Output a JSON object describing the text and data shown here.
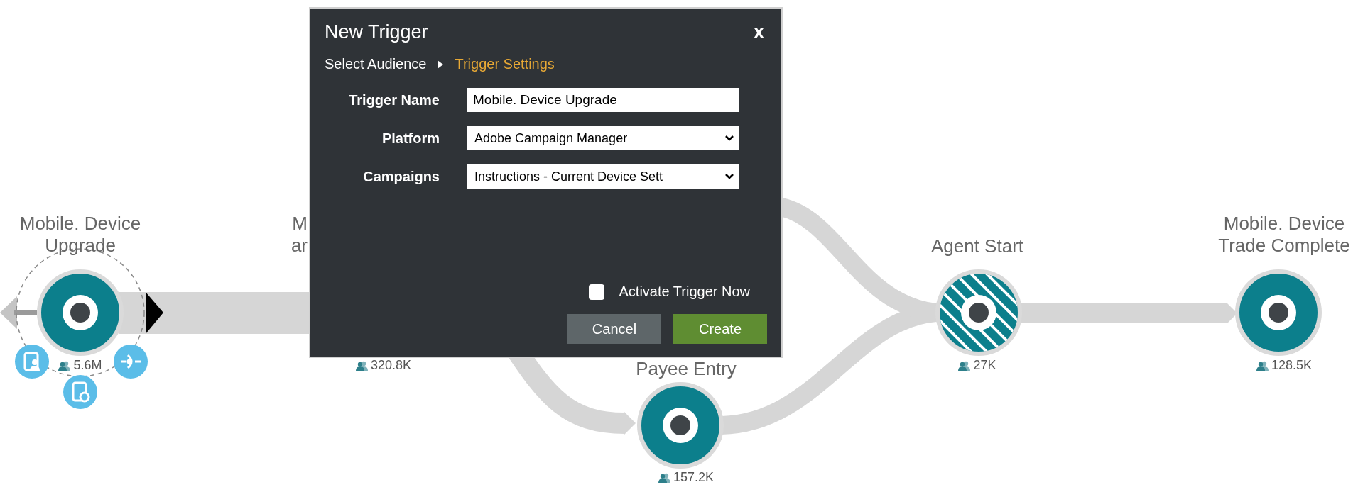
{
  "nodes": [
    {
      "label": [
        "Mobile. Device",
        "Upgrade"
      ],
      "count": "5.6M",
      "kind": "solid",
      "selected": true
    },
    {
      "label": [
        "M",
        "ar"
      ],
      "count": "320.8K",
      "kind": "hidden",
      "selected": false
    },
    {
      "label": [
        "Payee Entry"
      ],
      "count": "157.2K",
      "kind": "solid",
      "selected": false
    },
    {
      "label": [
        "Agent Start"
      ],
      "count": "27K",
      "kind": "hatched",
      "selected": false
    },
    {
      "label": [
        "Mobile. Device",
        "Trade Complete"
      ],
      "count": "128.5K",
      "kind": "solid",
      "selected": false
    }
  ],
  "dialog": {
    "title": "New Trigger",
    "close": "x",
    "steps": [
      {
        "label": "Select Audience",
        "selected": false
      },
      {
        "label": "Trigger Settings",
        "selected": true
      }
    ],
    "fields": [
      {
        "label": "Trigger Name",
        "kind": "text",
        "value": "Mobile. Device Upgrade"
      },
      {
        "label": "Platform",
        "kind": "select",
        "value": "Adobe Campaign Manager"
      },
      {
        "label": "Campaigns",
        "kind": "select",
        "value": "Instructions - Current Device Sett"
      }
    ],
    "activate": {
      "label": "Activate Trigger Now",
      "checked": false
    },
    "buttons": [
      {
        "label": "Cancel",
        "kind": "secondary"
      },
      {
        "label": "Create",
        "kind": "primary"
      }
    ]
  }
}
